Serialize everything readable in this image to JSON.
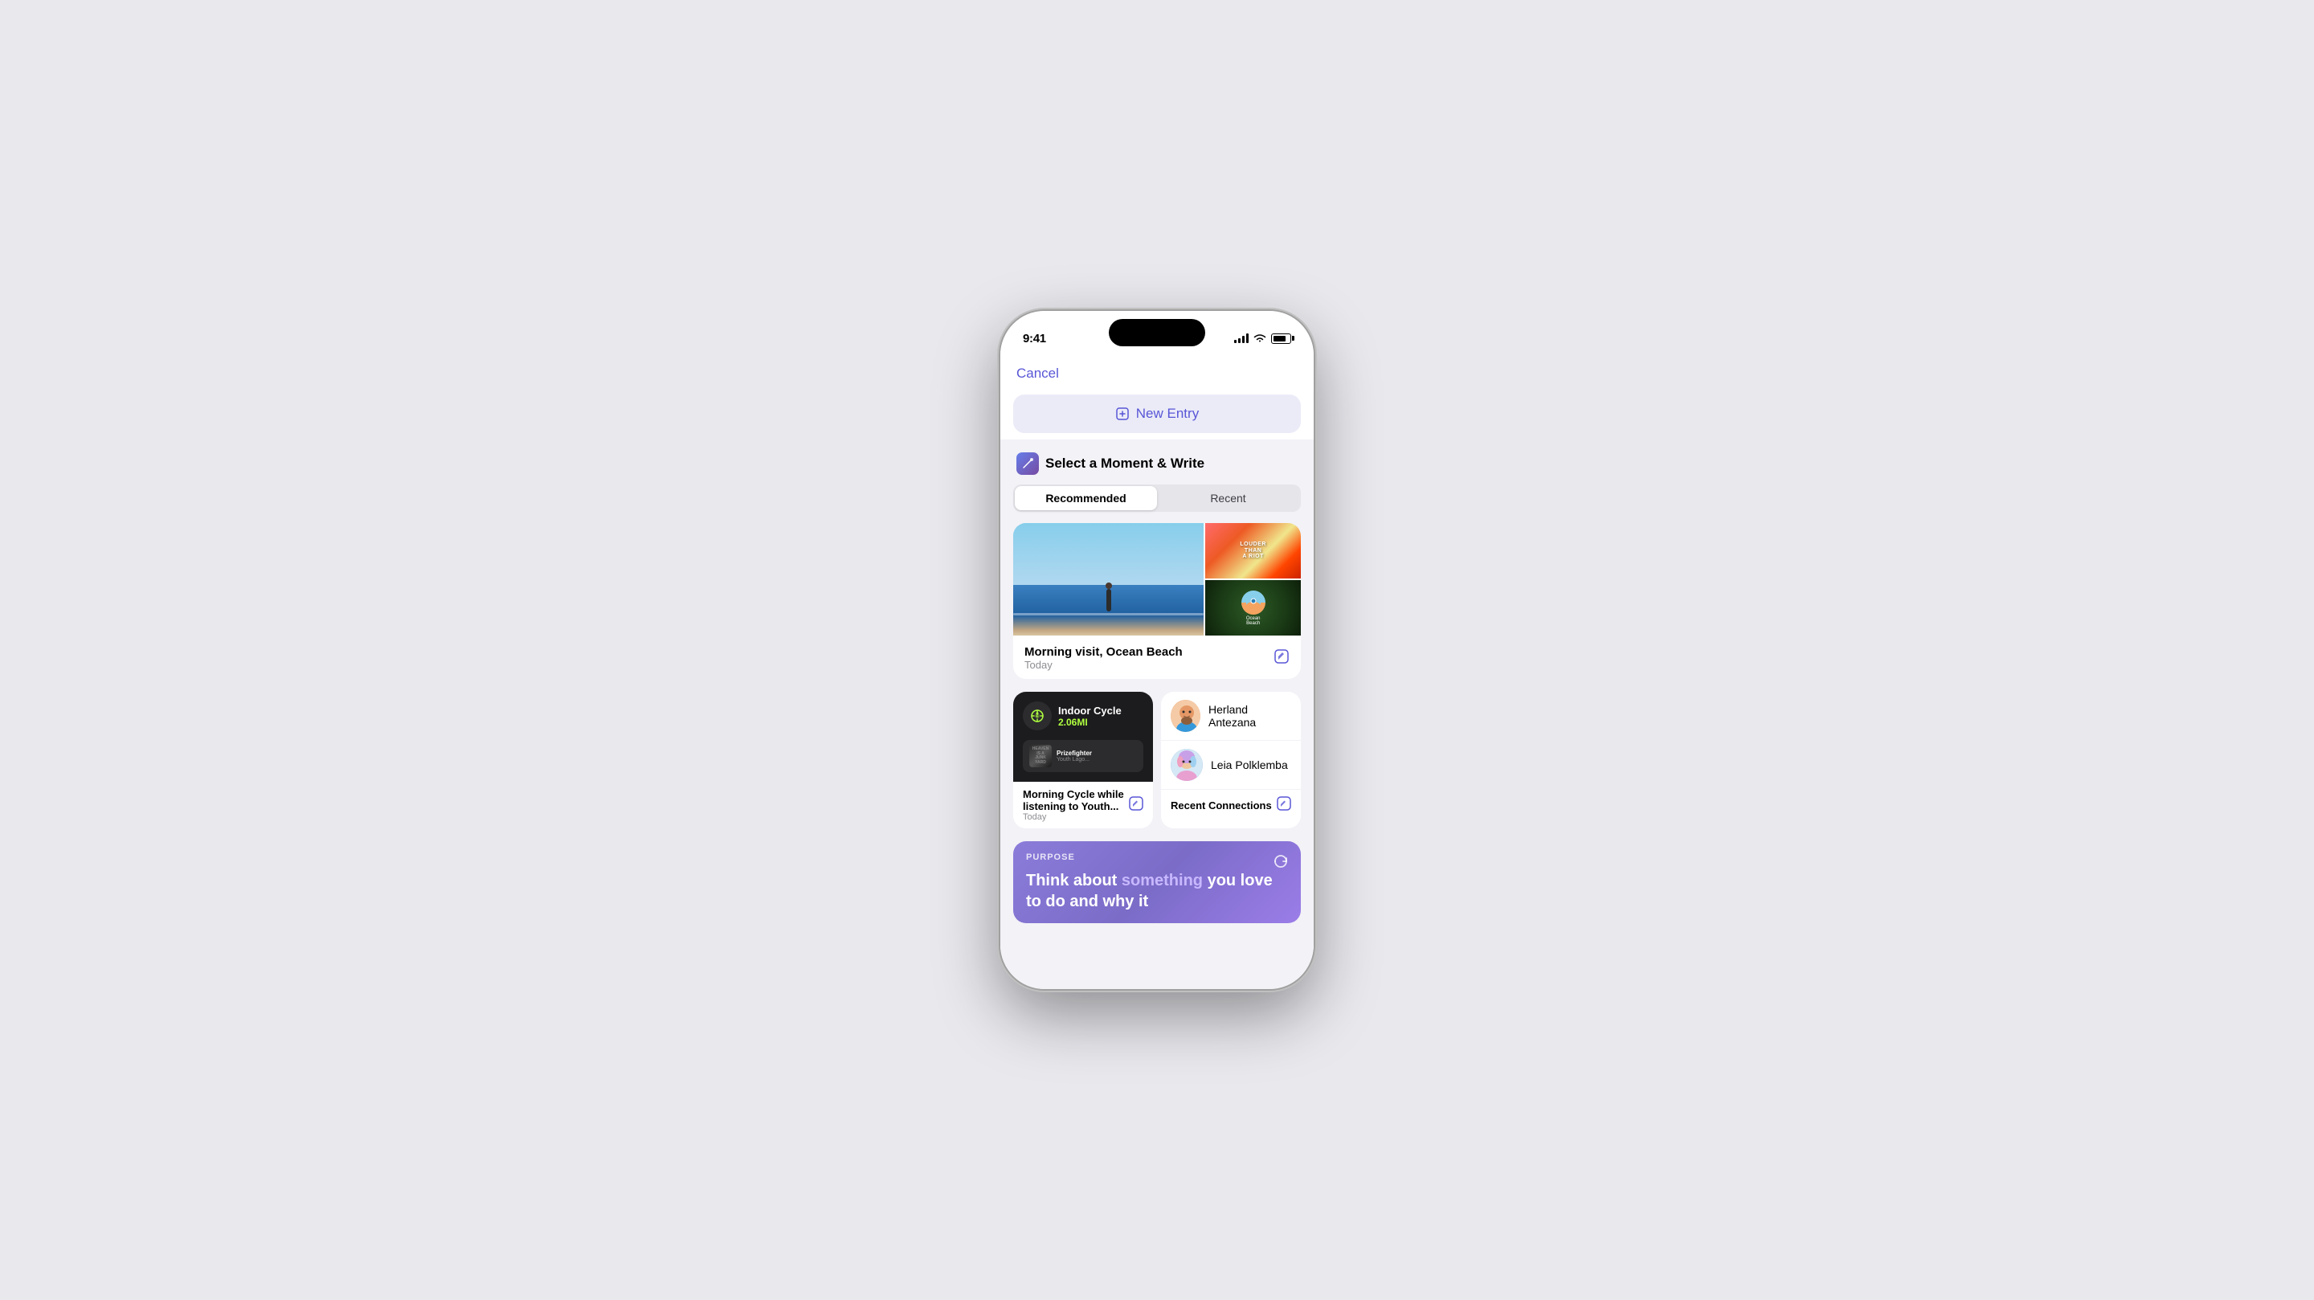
{
  "statusBar": {
    "time": "9:41",
    "batteryLevel": "80"
  },
  "header": {
    "cancelLabel": "Cancel",
    "newEntryLabel": "New Entry"
  },
  "section": {
    "title": "Select a Moment & Write",
    "iconLabel": "✏️"
  },
  "tabs": {
    "recommended": "Recommended",
    "recent": "Recent",
    "active": "recommended"
  },
  "moment1": {
    "title": "Morning visit, Ocean Beach",
    "date": "Today",
    "images": {
      "main": "beach-surfer",
      "topRight": "louder-than-a-riot",
      "midRight": "ocean-beach",
      "bottomLeft": "seashell",
      "bottomRight": "dog-field"
    }
  },
  "moment2": {
    "title": "Morning Cycle while listening to Youth...",
    "date": "Today",
    "activity": {
      "name": "Indoor Cycle",
      "distance": "2.06MI",
      "music": {
        "artist": "Prizefighter",
        "album": "Youth Lago..."
      }
    }
  },
  "connections": {
    "title": "Recent Connections",
    "people": [
      {
        "name": "Herland Antezana"
      },
      {
        "name": "Leia Polklemba"
      }
    ]
  },
  "purpose": {
    "label": "PURPOSE",
    "textStart": "Think about ",
    "textHighlight": "something",
    "textEnd": " you love to do and why it"
  }
}
